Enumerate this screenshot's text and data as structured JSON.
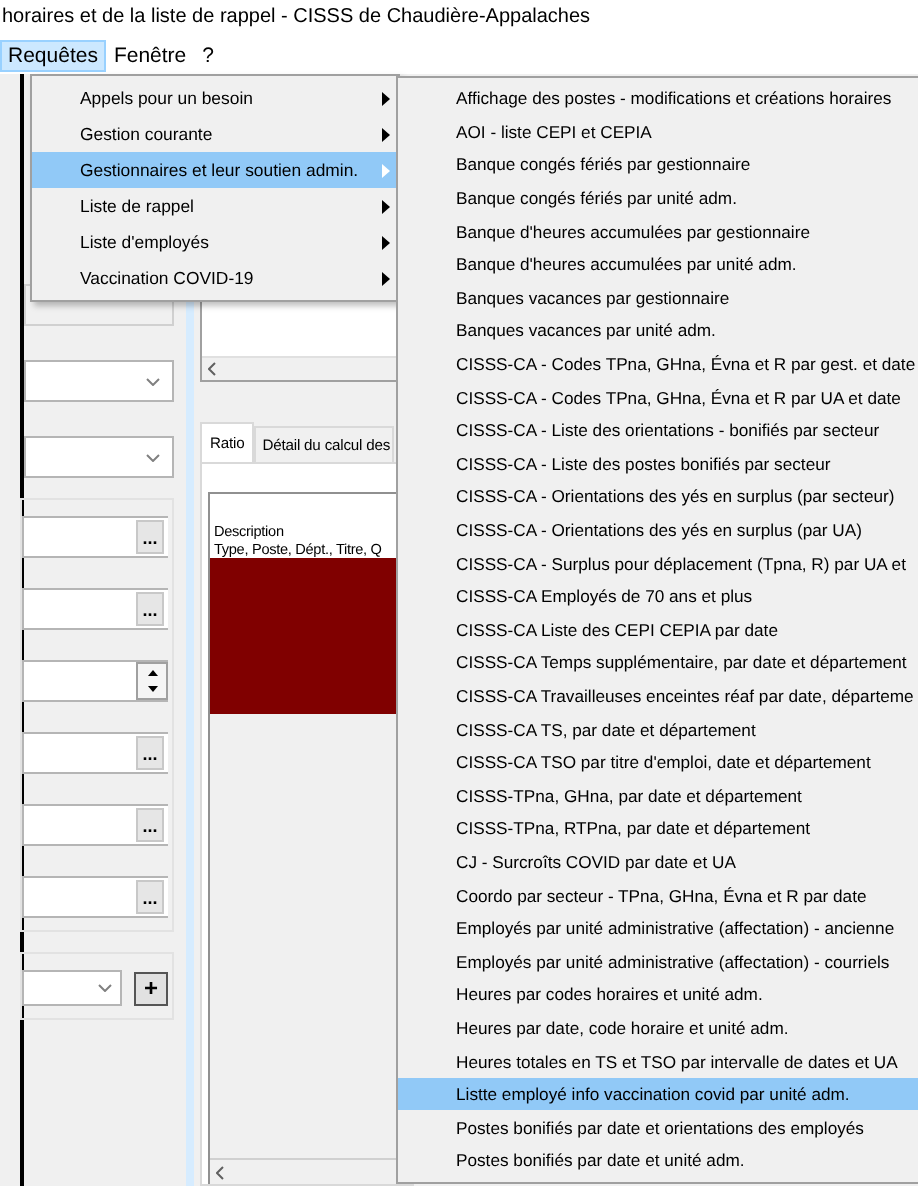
{
  "window": {
    "title": "horaires et de la liste de rappel - CISSS de Chaudière-Appalaches"
  },
  "menu_bar": [
    {
      "label": "Requêtes",
      "selected": true
    },
    {
      "label": "Fenêtre",
      "selected": false
    },
    {
      "label": "?",
      "selected": false
    }
  ],
  "requetes_menu": [
    {
      "label": "Appels pour un besoin",
      "has_submenu": true,
      "selected": false
    },
    {
      "label": "Gestion courante",
      "has_submenu": true,
      "selected": false
    },
    {
      "label": "Gestionnaires et leur soutien admin.",
      "has_submenu": true,
      "selected": true
    },
    {
      "label": "Liste de rappel",
      "has_submenu": true,
      "selected": false
    },
    {
      "label": "Liste d'employés",
      "has_submenu": true,
      "selected": false
    },
    {
      "label": "Vaccination COVID-19",
      "has_submenu": true,
      "selected": false
    }
  ],
  "submenu": [
    {
      "label": "Affichage des postes - modifications et créations horaires",
      "selected": false
    },
    {
      "label": "AOI - liste CEPI et CEPIA",
      "selected": false
    },
    {
      "label": "Banque congés fériés par gestionnaire",
      "selected": false
    },
    {
      "label": "Banque congés fériés par unité adm.",
      "selected": false
    },
    {
      "label": "Banque d'heures accumulées par gestionnaire",
      "selected": false
    },
    {
      "label": "Banque d'heures accumulées par unité adm.",
      "selected": false
    },
    {
      "label": "Banques vacances par gestionnaire",
      "selected": false
    },
    {
      "label": "Banques vacances par unité adm.",
      "selected": false
    },
    {
      "label": "CISSS-CA - Codes TPna, GHna, Évna et R par gest. et date",
      "selected": false
    },
    {
      "label": "CISSS-CA - Codes TPna, GHna, Évna et R par UA et date",
      "selected": false
    },
    {
      "label": "CISSS-CA - Liste des orientations - bonifiés par secteur",
      "selected": false
    },
    {
      "label": "CISSS-CA - Liste des postes bonifiés par secteur",
      "selected": false
    },
    {
      "label": "CISSS-CA - Orientations des yés en surplus (par secteur)",
      "selected": false
    },
    {
      "label": "CISSS-CA - Orientations des yés en surplus (par UA)",
      "selected": false
    },
    {
      "label": "CISSS-CA - Surplus pour déplacement (Tpna, R) par UA et",
      "selected": false
    },
    {
      "label": "CISSS-CA Employés de 70 ans et plus",
      "selected": false
    },
    {
      "label": "CISSS-CA Liste des CEPI CEPIA  par date",
      "selected": false
    },
    {
      "label": "CISSS-CA Temps supplémentaire, par date et département",
      "selected": false
    },
    {
      "label": "CISSS-CA Travailleuses enceintes réaf par date, départeme",
      "selected": false
    },
    {
      "label": "CISSS-CA TS, par date et département",
      "selected": false
    },
    {
      "label": "CISSS-CA TSO par titre d'emploi, date et département",
      "selected": false
    },
    {
      "label": "CISSS-TPna, GHna, par date et département",
      "selected": false
    },
    {
      "label": "CISSS-TPna, RTPna, par date et département",
      "selected": false
    },
    {
      "label": "CJ - Surcroîts COVID par date et UA",
      "selected": false
    },
    {
      "label": "Coordo par secteur - TPna, GHna, Évna et R par date",
      "selected": false
    },
    {
      "label": "Employés par unité administrative (affectation) - ancienne",
      "selected": false
    },
    {
      "label": "Employés par unité administrative (affectation) - courriels",
      "selected": false
    },
    {
      "label": "Heures par codes horaires et unité adm.",
      "selected": false
    },
    {
      "label": "Heures par date, code horaire et unité adm.",
      "selected": false
    },
    {
      "label": "Heures totales en TS et TSO par intervalle de dates et UA",
      "selected": false
    },
    {
      "label": "Listte employé  info vaccination covid par unité adm.",
      "selected": true
    },
    {
      "label": "Postes bonifiés par date et orientations des employés",
      "selected": false
    },
    {
      "label": "Postes bonifiés par date et unité adm.",
      "selected": false
    }
  ],
  "form_groups": [
    {
      "boxed": false,
      "fields": [
        {
          "kind": "text",
          "disabled": true
        },
        {
          "kind": "dropdown",
          "disabled": false
        },
        {
          "kind": "dropdown",
          "disabled": false
        }
      ]
    },
    {
      "boxed": true,
      "fields": [
        {
          "kind": "browse",
          "button": "..."
        },
        {
          "kind": "browse",
          "button": "..."
        },
        {
          "kind": "spinner"
        },
        {
          "kind": "browse",
          "button": "..."
        },
        {
          "kind": "browse",
          "button": "..."
        },
        {
          "kind": "browse",
          "button": "..."
        }
      ]
    },
    {
      "boxed": true,
      "fields": [
        {
          "kind": "combo-add",
          "button": "+"
        }
      ]
    }
  ],
  "tabs": [
    {
      "label": "Ratio",
      "selected": true
    },
    {
      "label": "Détail du calcul des",
      "selected": false
    }
  ],
  "grid_header": [
    "Description",
    "Type, Poste, Dépt., Titre, Q"
  ]
}
